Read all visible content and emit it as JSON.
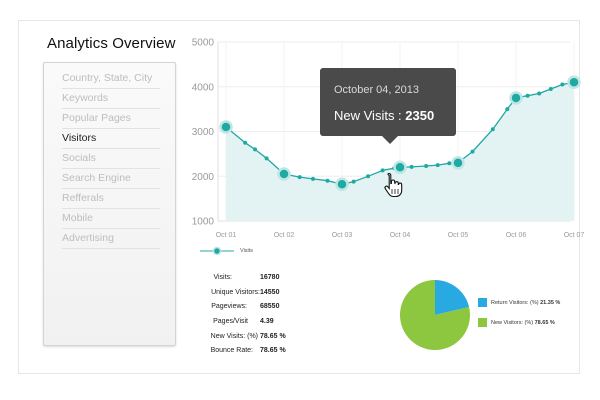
{
  "page": {
    "title": "Analytics Overview"
  },
  "sidebar": {
    "items": [
      {
        "label": "Country, State, City",
        "active": false
      },
      {
        "label": "Keywords",
        "active": false
      },
      {
        "label": "Popular Pages",
        "active": false
      },
      {
        "label": "Visitors",
        "active": true
      },
      {
        "label": "Socials",
        "active": false
      },
      {
        "label": "Search Engine",
        "active": false
      },
      {
        "label": "Refferals",
        "active": false
      },
      {
        "label": "Mobile",
        "active": false
      },
      {
        "label": "Advertising",
        "active": false
      }
    ]
  },
  "tooltip": {
    "date": "October 04, 2013",
    "label": "New Visits : ",
    "value": "2350"
  },
  "stats": [
    {
      "label": "Visits:",
      "value": "16780"
    },
    {
      "label": "Unique Visitors:",
      "value": "14550"
    },
    {
      "label": "Pageviews:",
      "value": "68550"
    },
    {
      "label": "Pages/Visit",
      "value": "4.39"
    },
    {
      "label": "New Visits: (%)",
      "value": "78.65 %"
    },
    {
      "label": "Bounce Rate:",
      "value": "78.65 %"
    }
  ],
  "colors": {
    "line": "#1fa9a3",
    "area": "#e3f3f3",
    "pie_return": "#29a9e1",
    "pie_new": "#8dc63f",
    "tooltip_bg": "#4a4a4a"
  },
  "icons": {
    "cursor": "hand-pointer-icon"
  },
  "chart_data": [
    {
      "type": "line",
      "categories": [
        "Oct 01",
        "Oct 02",
        "Oct 03",
        "Oct 04",
        "Oct 05",
        "Oct 06",
        "Oct 07"
      ],
      "x": [
        1,
        1.33,
        1.5,
        1.7,
        2,
        2.27,
        2.5,
        2.75,
        3,
        3.2,
        3.45,
        3.7,
        3.9,
        4,
        4.2,
        4.45,
        4.65,
        4.85,
        5,
        5.25,
        5.6,
        5.85,
        6,
        6.2,
        6.4,
        6.6,
        6.8,
        7
      ],
      "series": [
        {
          "name": "Visits",
          "values": [
            3100,
            2750,
            2600,
            2400,
            2050,
            1980,
            1940,
            1900,
            1820,
            1880,
            2000,
            2130,
            2180,
            2200,
            2210,
            2230,
            2250,
            2290,
            2300,
            2550,
            3050,
            3500,
            3750,
            3800,
            3850,
            3950,
            4050,
            4100
          ],
          "markers_at": [
            1,
            2,
            3,
            4,
            5,
            6,
            7
          ]
        }
      ],
      "yticks": [
        1000,
        2000,
        3000,
        4000,
        5000
      ],
      "ylim": [
        1000,
        5000
      ],
      "xlim": [
        1,
        7
      ],
      "grid": true,
      "legend": "bottom-left"
    },
    {
      "type": "pie",
      "slices": [
        {
          "name": "Return Visitors: (%)",
          "value": 21.35,
          "label": "21.35 %"
        },
        {
          "name": "New Visitors: (%)",
          "value": 78.65,
          "label": "78.65 %"
        }
      ]
    }
  ]
}
